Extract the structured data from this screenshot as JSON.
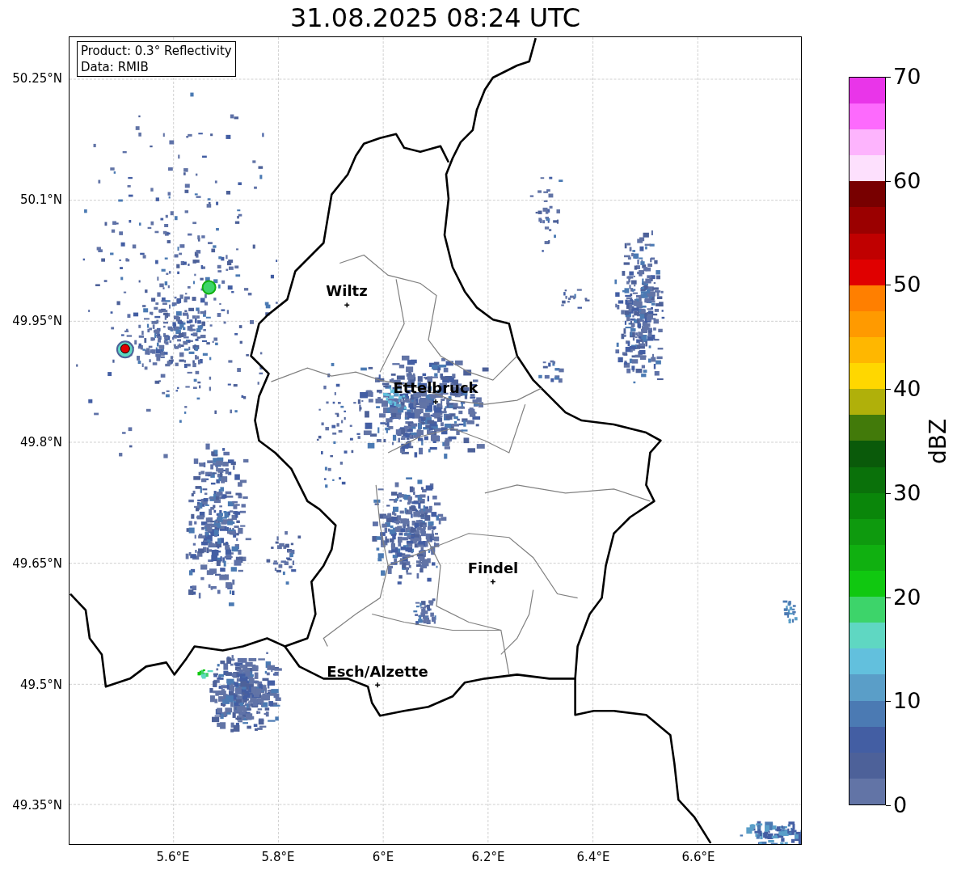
{
  "figure": {
    "title": "31.08.2025 08:24 UTC"
  },
  "info_box": {
    "lines": [
      "Product: 0.3° Reflectivity",
      "Data: RMIB"
    ]
  },
  "y_ticks": [
    "50.25°N",
    "50.1°N",
    "49.95°N",
    "49.8°N",
    "49.65°N",
    "49.5°N",
    "49.35°N"
  ],
  "x_ticks": [
    "5.6°E",
    "5.8°E",
    "6°E",
    "6.2°E",
    "6.4°E",
    "6.6°E"
  ],
  "cities": [
    {
      "name": "Wiltz"
    },
    {
      "name": "Ettelbruck"
    },
    {
      "name": "Findel"
    },
    {
      "name": "Esch/Alzette"
    }
  ],
  "colorbar": {
    "label": "dBZ",
    "ticks": [
      "70",
      "60",
      "50",
      "40",
      "30",
      "20",
      "10",
      "0"
    ],
    "bands": [
      {
        "color": "#6274a6"
      },
      {
        "color": "#4d6199"
      },
      {
        "color": "#435ea3"
      },
      {
        "color": "#4b7ab3"
      },
      {
        "color": "#5a9ec8"
      },
      {
        "color": "#62c0dd"
      },
      {
        "color": "#5fd7c2"
      },
      {
        "color": "#3dd46a"
      },
      {
        "color": "#10c810"
      },
      {
        "color": "#10b010"
      },
      {
        "color": "#0e9a0e"
      },
      {
        "color": "#0a860a"
      },
      {
        "color": "#0a710a"
      },
      {
        "color": "#0a5a0a"
      },
      {
        "color": "#427a0a"
      },
      {
        "color": "#b0b00a"
      },
      {
        "color": "#ffd700"
      },
      {
        "color": "#ffb700"
      },
      {
        "color": "#ff9a00"
      },
      {
        "color": "#ff7f00"
      },
      {
        "color": "#e00000"
      },
      {
        "color": "#c00000"
      },
      {
        "color": "#9b0000"
      },
      {
        "color": "#780000"
      },
      {
        "color": "#fde0fd"
      },
      {
        "color": "#fdb4fd"
      },
      {
        "color": "#fd6afd"
      },
      {
        "color": "#e935e9"
      }
    ]
  }
}
